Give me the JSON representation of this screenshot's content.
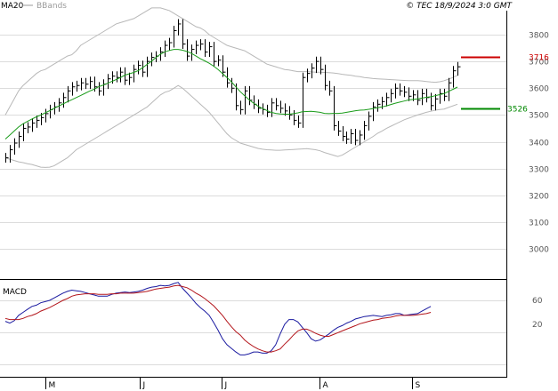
{
  "header": {
    "legend": [
      {
        "label": "MA20",
        "color": "#1a9c1a"
      },
      {
        "label": "BBands",
        "color": "#9a9a9a"
      }
    ],
    "copyright": "© TEC 18/9/2024 3:0 GMT"
  },
  "price_panel": {
    "ylim": [
      2900,
      3900
    ],
    "y_ticks": [
      3800,
      3700,
      3600,
      3500,
      3400,
      3300,
      3200,
      3100,
      3000
    ],
    "markers": [
      {
        "value": 3716,
        "label": "3716",
        "color": "#cc0000"
      },
      {
        "value": 3526,
        "label": "3526",
        "color": "#008800"
      }
    ]
  },
  "macd_panel": {
    "title": "MACD",
    "ylim": [
      -40,
      100
    ],
    "y_ticks": [
      {
        "value": 60,
        "label": "60"
      },
      {
        "value": 20,
        "label": "20"
      }
    ]
  },
  "x_ticks": [
    "M",
    "J",
    "J",
    "A",
    "S"
  ],
  "chart_data": {
    "type": "line",
    "title": "",
    "xlabel": "",
    "ylabel": "",
    "price": {
      "close": [
        3340,
        3370,
        3395,
        3420,
        3450,
        3455,
        3470,
        3480,
        3490,
        3505,
        3520,
        3530,
        3545,
        3565,
        3590,
        3605,
        3610,
        3620,
        3615,
        3625,
        3605,
        3590,
        3615,
        3635,
        3645,
        3640,
        3660,
        3630,
        3640,
        3670,
        3685,
        3660,
        3700,
        3715,
        3720,
        3735,
        3760,
        3770,
        3815,
        3840,
        3765,
        3720,
        3745,
        3760,
        3765,
        3735,
        3755,
        3700,
        3705,
        3660,
        3620,
        3600,
        3535,
        3520,
        3590,
        3555,
        3540,
        3525,
        3520,
        3510,
        3545,
        3535,
        3525,
        3515,
        3500,
        3480,
        3470,
        3640,
        3655,
        3675,
        3700,
        3670,
        3610,
        3590,
        3460,
        3440,
        3420,
        3410,
        3430,
        3405,
        3425,
        3460,
        3495,
        3530,
        3540,
        3550,
        3565,
        3580,
        3600,
        3590,
        3585,
        3570,
        3575,
        3555,
        3580,
        3565,
        3535,
        3560,
        3580,
        3570,
        3620,
        3665,
        3680
      ],
      "ma20": [
        3410,
        3425,
        3440,
        3455,
        3467,
        3476,
        3485,
        3493,
        3500,
        3508,
        3516,
        3525,
        3533,
        3541,
        3549,
        3557,
        3565,
        3573,
        3581,
        3589,
        3596,
        3605,
        3611,
        3618,
        3625,
        3632,
        3640,
        3649,
        3654,
        3659,
        3666,
        3677,
        3689,
        3701,
        3715,
        3727,
        3736,
        3741,
        3745,
        3745,
        3742,
        3737,
        3730,
        3720,
        3710,
        3702,
        3693,
        3682,
        3670,
        3655,
        3640,
        3624,
        3605,
        3587,
        3572,
        3557,
        3544,
        3533,
        3524,
        3517,
        3510,
        3506,
        3504,
        3503,
        3503,
        3505,
        3508,
        3512,
        3513,
        3514,
        3512,
        3510,
        3506,
        3505,
        3506,
        3506,
        3507,
        3510,
        3513,
        3516,
        3518,
        3519,
        3521,
        3524,
        3527,
        3530,
        3534,
        3539,
        3544,
        3548,
        3552,
        3556,
        3558,
        3560,
        3563,
        3566,
        3568,
        3572,
        3576,
        3580,
        3588,
        3596,
        3604
      ],
      "bb_upper": [
        3500,
        3530,
        3560,
        3590,
        3610,
        3625,
        3640,
        3655,
        3665,
        3670,
        3680,
        3690,
        3700,
        3710,
        3720,
        3725,
        3740,
        3760,
        3770,
        3780,
        3790,
        3800,
        3810,
        3820,
        3830,
        3840,
        3845,
        3850,
        3855,
        3860,
        3870,
        3880,
        3890,
        3900,
        3900,
        3900,
        3895,
        3890,
        3880,
        3870,
        3860,
        3850,
        3840,
        3830,
        3825,
        3815,
        3800,
        3790,
        3780,
        3770,
        3760,
        3755,
        3750,
        3745,
        3740,
        3730,
        3720,
        3710,
        3700,
        3690,
        3685,
        3680,
        3675,
        3670,
        3668,
        3665,
        3662,
        3662,
        3662,
        3661,
        3660,
        3660,
        3659,
        3658,
        3657,
        3655,
        3652,
        3650,
        3648,
        3645,
        3643,
        3640,
        3638,
        3636,
        3635,
        3634,
        3633,
        3632,
        3631,
        3630,
        3629,
        3628,
        3628,
        3628,
        3627,
        3625,
        3623,
        3622,
        3624,
        3628,
        3634,
        3640,
        3648
      ],
      "bb_lower": [
        3340,
        3335,
        3330,
        3325,
        3322,
        3318,
        3315,
        3310,
        3305,
        3304,
        3305,
        3310,
        3320,
        3330,
        3340,
        3355,
        3370,
        3380,
        3390,
        3400,
        3410,
        3420,
        3430,
        3440,
        3450,
        3460,
        3470,
        3480,
        3490,
        3500,
        3510,
        3520,
        3530,
        3545,
        3560,
        3575,
        3585,
        3590,
        3600,
        3610,
        3600,
        3585,
        3570,
        3555,
        3540,
        3525,
        3510,
        3490,
        3470,
        3450,
        3430,
        3415,
        3405,
        3395,
        3390,
        3385,
        3380,
        3375,
        3372,
        3370,
        3369,
        3368,
        3368,
        3369,
        3370,
        3371,
        3372,
        3373,
        3374,
        3372,
        3370,
        3366,
        3360,
        3355,
        3350,
        3345,
        3350,
        3360,
        3370,
        3380,
        3390,
        3400,
        3410,
        3420,
        3432,
        3440,
        3450,
        3458,
        3466,
        3474,
        3482,
        3488,
        3494,
        3500,
        3505,
        3510,
        3514,
        3518,
        3520,
        3522,
        3528,
        3534,
        3540
      ]
    },
    "macd": {
      "macd": [
        25,
        22,
        26,
        35,
        40,
        45,
        50,
        52,
        56,
        58,
        60,
        64,
        68,
        72,
        75,
        77,
        76,
        75,
        73,
        71,
        69,
        67,
        67,
        67,
        70,
        72,
        73,
        74,
        73,
        74,
        75,
        77,
        80,
        82,
        83,
        85,
        84,
        85,
        88,
        90,
        80,
        72,
        64,
        55,
        48,
        42,
        35,
        23,
        10,
        -4,
        -14,
        -20,
        -26,
        -31,
        -31,
        -29,
        -26,
        -26,
        -28,
        -28,
        -24,
        -14,
        4,
        20,
        28,
        28,
        24,
        15,
        6,
        -4,
        -8,
        -6,
        -1,
        4,
        10,
        15,
        18,
        22,
        25,
        29,
        31,
        33,
        34,
        35,
        34,
        33,
        35,
        36,
        38,
        38,
        35,
        36,
        37,
        38,
        42,
        46,
        50
      ],
      "signal": [
        30,
        28,
        28,
        28,
        30,
        33,
        35,
        38,
        42,
        45,
        48,
        52,
        56,
        60,
        63,
        67,
        69,
        70,
        71,
        71,
        71,
        70,
        70,
        70,
        71,
        71,
        72,
        72,
        72,
        72,
        73,
        74,
        75,
        77,
        79,
        80,
        81,
        82,
        84,
        85,
        83,
        81,
        77,
        72,
        68,
        63,
        57,
        51,
        43,
        35,
        25,
        16,
        8,
        2,
        -6,
        -12,
        -17,
        -21,
        -24,
        -26,
        -26,
        -24,
        -21,
        -13,
        -6,
        2,
        9,
        12,
        12,
        9,
        5,
        2,
        0,
        0,
        3,
        6,
        9,
        12,
        15,
        18,
        21,
        23,
        25,
        27,
        28,
        30,
        31,
        32,
        34,
        35,
        35,
        35,
        35,
        36,
        37,
        38,
        40
      ]
    },
    "series": [
      {
        "name": "MA20",
        "color": "#1a9c1a"
      },
      {
        "name": "BBands",
        "color": "#9a9a9a"
      },
      {
        "name": "",
        "color": "#1a1aa0"
      },
      {
        "name": "",
        "color": "#b3151b"
      }
    ]
  }
}
